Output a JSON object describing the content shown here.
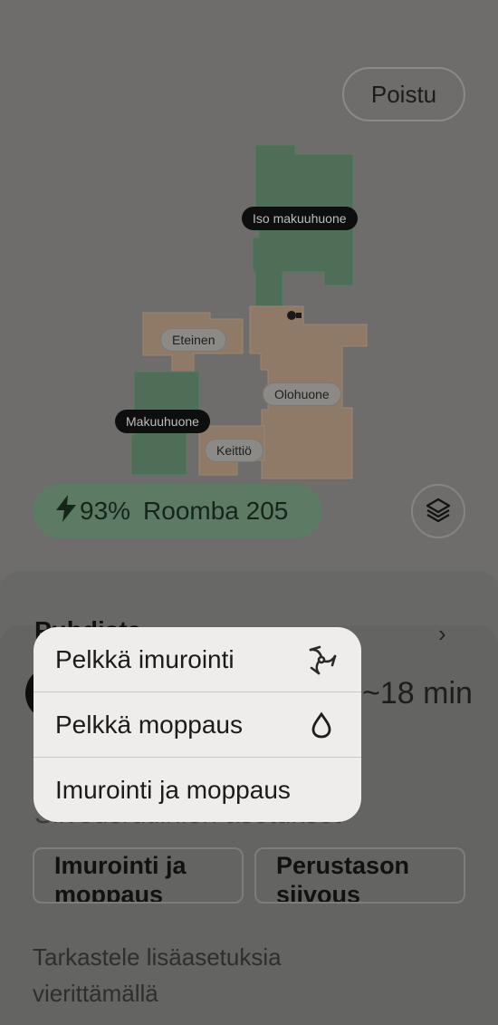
{
  "header": {
    "exit_label": "Poistu"
  },
  "map": {
    "rooms": [
      {
        "name": "Iso makuuhuone",
        "style": "dark"
      },
      {
        "name": "Eteinen",
        "style": "light"
      },
      {
        "name": "Olohuone",
        "style": "light"
      },
      {
        "name": "Makuuhuone",
        "style": "dark"
      },
      {
        "name": "Keittiö",
        "style": "light"
      }
    ],
    "colors": {
      "green_room": "#4e6e58",
      "orange_room": "#8e7a66"
    }
  },
  "robot": {
    "battery": "93%",
    "name": "Roomba 205",
    "bolt_icon": "lightning-icon"
  },
  "layers_icon": "layers-icon",
  "background_sheet": {
    "title": "Puhdista",
    "time": "~18 min",
    "settings_heading": "Siivousrutiinien asetukset",
    "mode_buttons": [
      "Imurointi ja moppaus",
      "Perustason siivous"
    ],
    "hint": "Tarkastele lisäasetuksia vierittämällä"
  },
  "popup_menu": {
    "items": [
      {
        "label": "Pelkkä imurointi",
        "icon": "fan-icon"
      },
      {
        "label": "Pelkkä moppaus",
        "icon": "drop-icon"
      },
      {
        "label": "Imurointi ja moppaus",
        "icon": ""
      }
    ]
  }
}
